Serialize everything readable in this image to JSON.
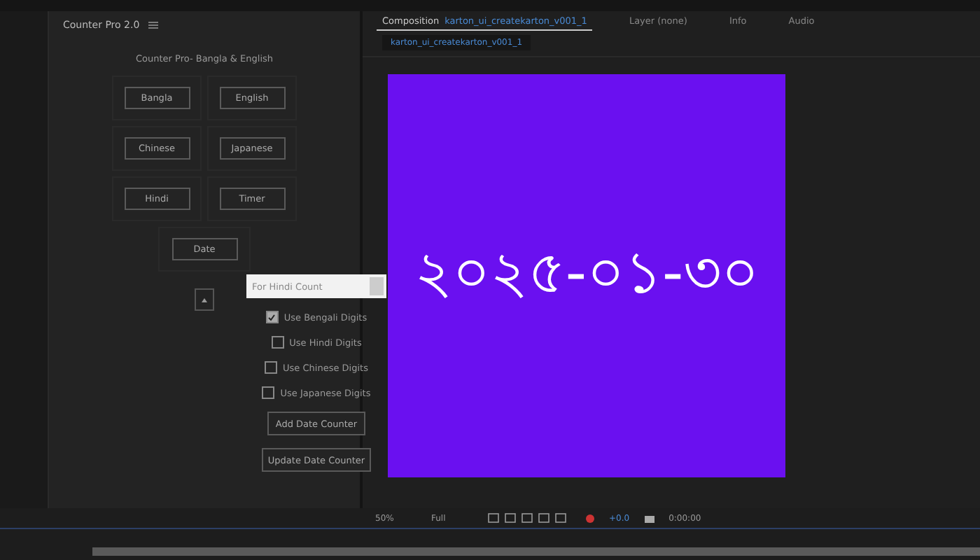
{
  "panel": {
    "title": "Counter Pro 2.0",
    "heading": "Counter Pro- Bangla & English",
    "buttons": [
      "Bangla",
      "English",
      "Chinese",
      "Japanese",
      "Hindi",
      "Timer"
    ],
    "date_button": "Date"
  },
  "popup": {
    "field": {
      "placeholder": "For Hindi Count"
    },
    "options": [
      {
        "label": "Use Bengali Digits",
        "checked": true
      },
      {
        "label": "Use Hindi Digits",
        "checked": false
      },
      {
        "label": "Use Chinese Digits",
        "checked": false
      },
      {
        "label": "Use Japanese Digits",
        "checked": false
      }
    ],
    "buttons": [
      "Add Date Counter",
      "Update Date Counter"
    ]
  },
  "composition": {
    "tabs": [
      {
        "label": "Composition",
        "name": "karton_ui_createkarton_v001_1",
        "selected": true
      },
      {
        "label": "Layer (none)",
        "selected": false
      },
      {
        "label": "Info",
        "selected": false
      },
      {
        "label": "Audio",
        "selected": false
      }
    ],
    "subtab": "karton_ui_createkarton_v001_1",
    "preview_text": "২০২৫-০১-৩০",
    "toolbar": {
      "zoom": "50%",
      "resolution": "Full",
      "exposure": "+0.0",
      "timecode": "0:00:00"
    }
  }
}
